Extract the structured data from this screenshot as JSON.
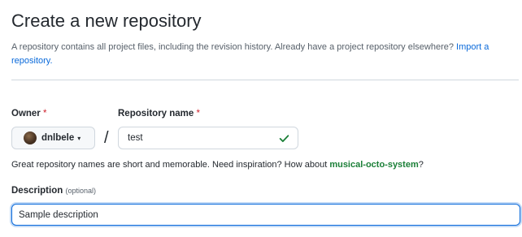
{
  "header": {
    "title": "Create a new repository",
    "subtitle": "A repository contains all project files, including the revision history. Already have a project repository elsewhere?",
    "import_link": "Import a repository."
  },
  "owner": {
    "label": "Owner",
    "required_mark": "*",
    "value": "dnlbele",
    "caret": "▾"
  },
  "separator": "/",
  "repository": {
    "label": "Repository name",
    "required_mark": "*",
    "value": "test",
    "status_icon": "check-icon",
    "status_color": "#1a7f37"
  },
  "hint": {
    "text": "Great repository names are short and memorable. Need inspiration? How about ",
    "suggestion": "musical-octo-system",
    "suffix": "?"
  },
  "description": {
    "label": "Description",
    "optional_note": "(optional)",
    "value": "Sample description"
  },
  "colors": {
    "link": "#0969da",
    "required": "#cf222e",
    "success": "#1a7f37"
  }
}
